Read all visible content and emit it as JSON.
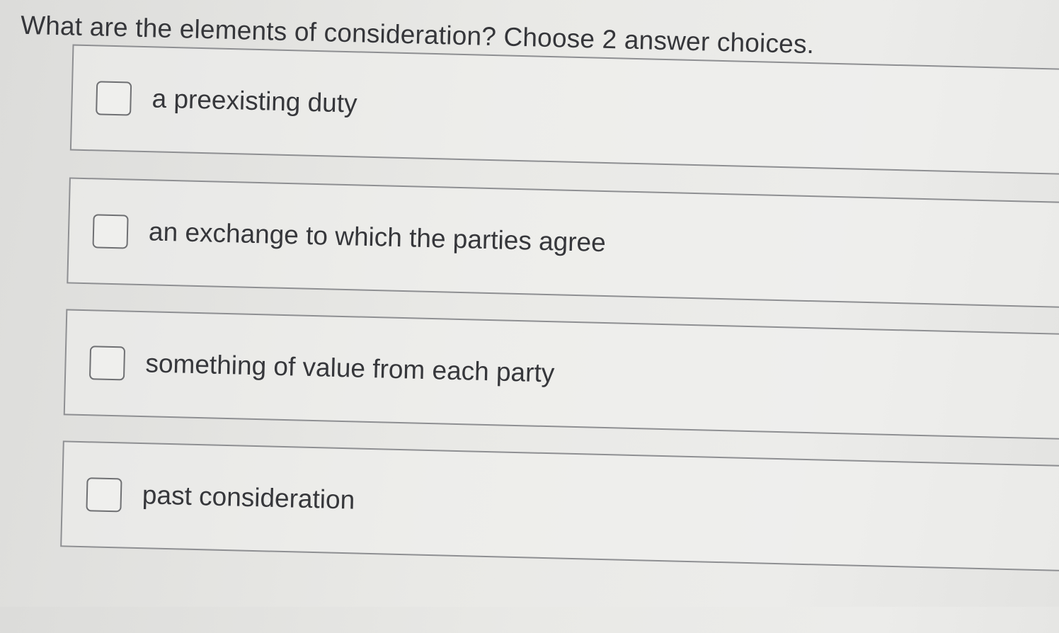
{
  "question": {
    "text": "What are the elements of consideration? Choose 2 answer choices."
  },
  "choices": [
    {
      "label": "a preexisting duty",
      "checked": false
    },
    {
      "label": "an exchange to which the parties agree",
      "checked": false
    },
    {
      "label": "something of value from each party",
      "checked": false
    },
    {
      "label": "past consideration",
      "checked": false
    }
  ],
  "colors": {
    "background": "#e9e9e6",
    "border": "#8e8f92",
    "text": "#36373b"
  }
}
